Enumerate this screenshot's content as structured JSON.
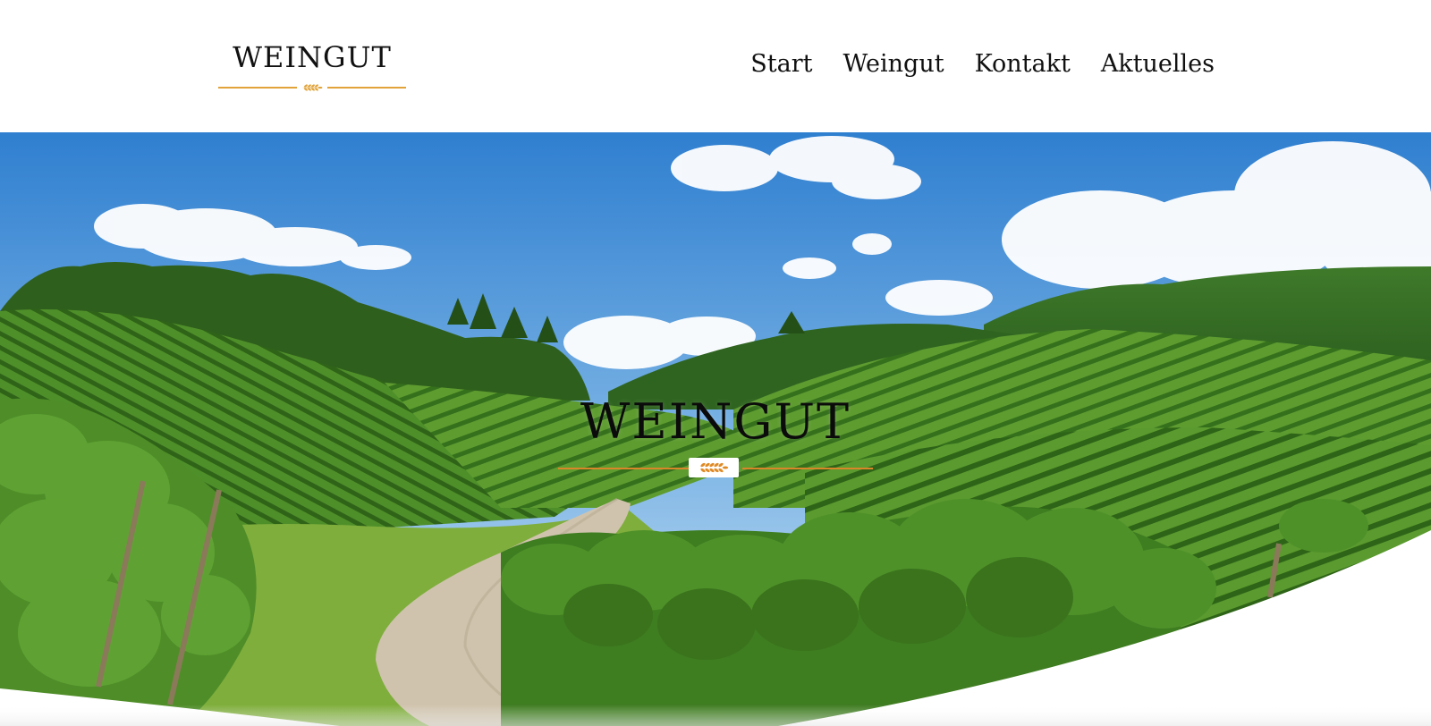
{
  "header": {
    "logo_text": "WEINGUT",
    "nav": [
      "Start",
      "Weingut",
      "Kontakt",
      "Aktuelles"
    ]
  },
  "hero": {
    "title": "WEINGUT"
  },
  "colors": {
    "accent": "#e1a33a",
    "hero_rule": "#d9862a",
    "text": "#111111",
    "sky": "#3f8fd8",
    "vineyard": "#4f8f2a"
  },
  "icons": {
    "logo_ornament": "wheat-icon",
    "hero_ornament": "wheat-icon"
  }
}
